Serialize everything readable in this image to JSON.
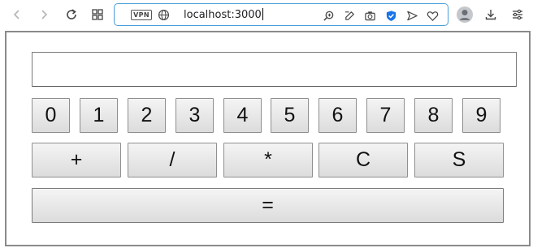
{
  "browser": {
    "url": "localhost:3000",
    "vpn_label": "VPN",
    "nav_icons": [
      "back-icon",
      "forward-icon",
      "reload-icon",
      "tab-grid-icon"
    ],
    "url_icons": [
      "zoom-icon",
      "edit-icon",
      "camera-icon",
      "shield-icon",
      "send-icon",
      "heart-icon"
    ],
    "right_icons": [
      "profile-icon",
      "download-icon",
      "settings-icon"
    ],
    "accent_color": "#4a9fd8",
    "shield_color": "#1a73e8"
  },
  "calculator": {
    "display_value": "",
    "digits": [
      "0",
      "1",
      "2",
      "3",
      "4",
      "5",
      "6",
      "7",
      "8",
      "9"
    ],
    "operators": [
      "+",
      "/",
      "*",
      "C",
      "S"
    ],
    "equals": "="
  }
}
